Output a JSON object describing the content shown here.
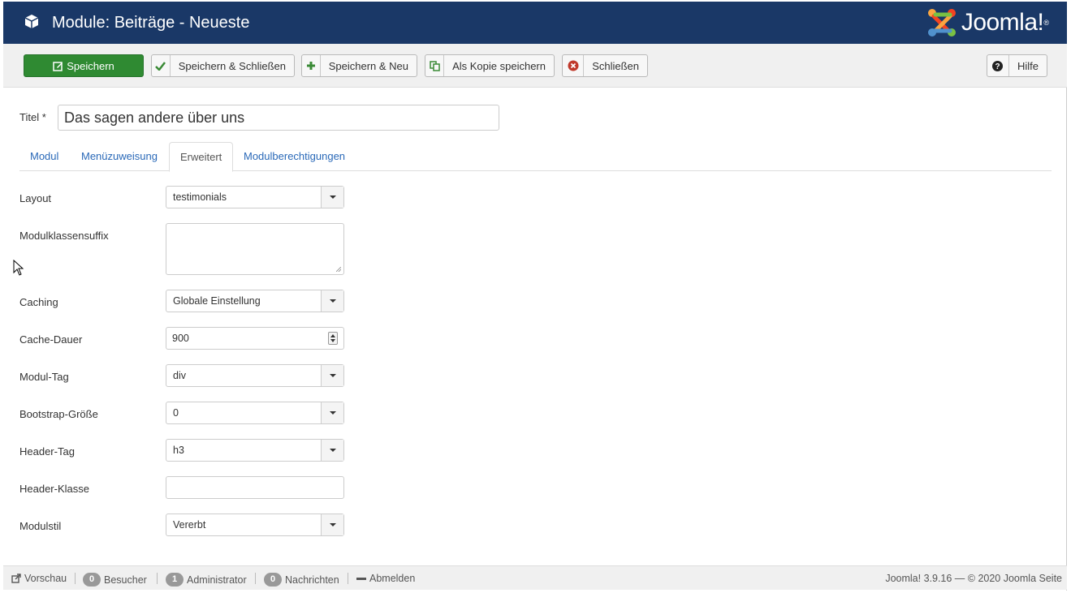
{
  "header": {
    "title": "Module: Beiträge - Neueste",
    "brand": "Joomla!",
    "brand_reg": "®"
  },
  "toolbar": {
    "save": "Speichern",
    "save_close": "Speichern & Schließen",
    "save_new": "Speichern & Neu",
    "save_copy": "Als Kopie speichern",
    "close": "Schließen",
    "help": "Hilfe"
  },
  "title_field": {
    "label": "Titel *",
    "value": "Das sagen andere über uns"
  },
  "tabs": {
    "modul": "Modul",
    "menu": "Menüzuweisung",
    "advanced": "Erweitert",
    "permissions": "Modulberechtigungen"
  },
  "form": {
    "layout_label": "Layout",
    "layout_value": "testimonials",
    "suffix_label": "Modulklassensuffix",
    "caching_label": "Caching",
    "caching_value": "Globale Einstellung",
    "cache_time_label": "Cache-Dauer",
    "cache_time_value": "900",
    "module_tag_label": "Modul-Tag",
    "module_tag_value": "div",
    "bootstrap_label": "Bootstrap-Größe",
    "bootstrap_value": "0",
    "header_tag_label": "Header-Tag",
    "header_tag_value": "h3",
    "header_class_label": "Header-Klasse",
    "style_label": "Modulstil",
    "style_value": "Vererbt"
  },
  "footer": {
    "preview": "Vorschau",
    "visitors_count": "0",
    "visitors": "Besucher",
    "admin_count": "1",
    "admin": "Administrator",
    "messages_count": "0",
    "messages": "Nachrichten",
    "logout": "Abmelden",
    "copyright": "Joomla! 3.9.16 — © 2020 Joomla Seite"
  },
  "colors": {
    "header_bg": "#1a3867",
    "save_green": "#2f8a32",
    "link_blue": "#2a69b8"
  }
}
